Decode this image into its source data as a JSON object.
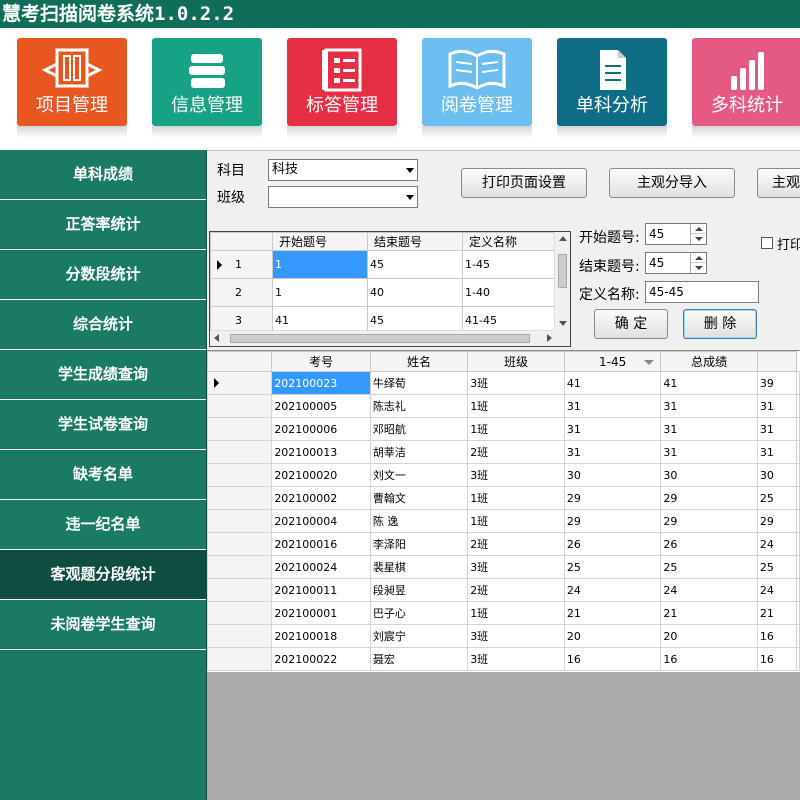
{
  "app": {
    "title": "慧考扫描阅卷系统1.0.2.2"
  },
  "toolbar": [
    {
      "label": "项目管理",
      "icon": "project-icon",
      "color": "#e8571f"
    },
    {
      "label": "信息管理",
      "icon": "books-icon",
      "color": "#17a285"
    },
    {
      "label": "标答管理",
      "icon": "answer-sheet-icon",
      "color": "#e62f45"
    },
    {
      "label": "阅卷管理",
      "icon": "open-book-icon",
      "color": "#6cbef0"
    },
    {
      "label": "单科分析",
      "icon": "document-icon",
      "color": "#0e6d85"
    },
    {
      "label": "多科统计",
      "icon": "bar-chart-icon",
      "color": "#e45a82"
    }
  ],
  "sidebar": [
    "单科成绩",
    "正答率统计",
    "分数段统计",
    "综合统计",
    "学生成绩查询",
    "学生试卷查询",
    "缺考名单",
    "违一纪名单",
    "客观题分段统计",
    "未阅卷学生查询"
  ],
  "filters": {
    "subject_label": "科目",
    "subject_value": "科技",
    "class_label": "班级",
    "class_value": ""
  },
  "buttons": {
    "print_setup": "打印页面设置",
    "import_subjective": "主观分导入",
    "subjective_cut": "主观",
    "confirm": "确 定",
    "delete": "删 除"
  },
  "print_check": {
    "label": "打印"
  },
  "range_form": {
    "start_label": "开始题号:",
    "start_value": "45",
    "end_label": "结束题号:",
    "end_value": "45",
    "name_label": "定义名称:",
    "name_value": "45-45"
  },
  "def_grid": {
    "headers": [
      "开始题号",
      "结束题号",
      "定义名称"
    ],
    "rows": [
      {
        "no": "1",
        "start": "1",
        "end": "45",
        "name": "1-45"
      },
      {
        "no": "2",
        "start": "1",
        "end": "40",
        "name": "1-40"
      },
      {
        "no": "3",
        "start": "41",
        "end": "45",
        "name": "41-45"
      }
    ]
  },
  "main_grid": {
    "headers": [
      "考号",
      "姓名",
      "班级",
      "1-45",
      "总成绩",
      ""
    ],
    "rows": [
      [
        "202100023",
        "牛绎荀",
        "3班",
        "41",
        "41",
        "39"
      ],
      [
        "202100005",
        "陈志礼",
        "1班",
        "31",
        "31",
        "31"
      ],
      [
        "202100006",
        "邓昭航",
        "1班",
        "31",
        "31",
        "31"
      ],
      [
        "202100013",
        "胡莘洁",
        "2班",
        "31",
        "31",
        "31"
      ],
      [
        "202100020",
        "刘文一",
        "3班",
        "30",
        "30",
        "30"
      ],
      [
        "202100002",
        "曹翰文",
        "1班",
        "29",
        "29",
        "25"
      ],
      [
        "202100004",
        "陈 逸",
        "1班",
        "29",
        "29",
        "29"
      ],
      [
        "202100016",
        "李泽阳",
        "2班",
        "26",
        "26",
        "24"
      ],
      [
        "202100024",
        "裴星棋",
        "3班",
        "25",
        "25",
        "25"
      ],
      [
        "202100011",
        "段昶昱",
        "2班",
        "24",
        "24",
        "24"
      ],
      [
        "202100001",
        "巴子心",
        "1班",
        "21",
        "21",
        "21"
      ],
      [
        "202100018",
        "刘宸宁",
        "3班",
        "20",
        "20",
        "16"
      ],
      [
        "202100022",
        "聂宏",
        "3班",
        "16",
        "16",
        "16"
      ]
    ]
  }
}
